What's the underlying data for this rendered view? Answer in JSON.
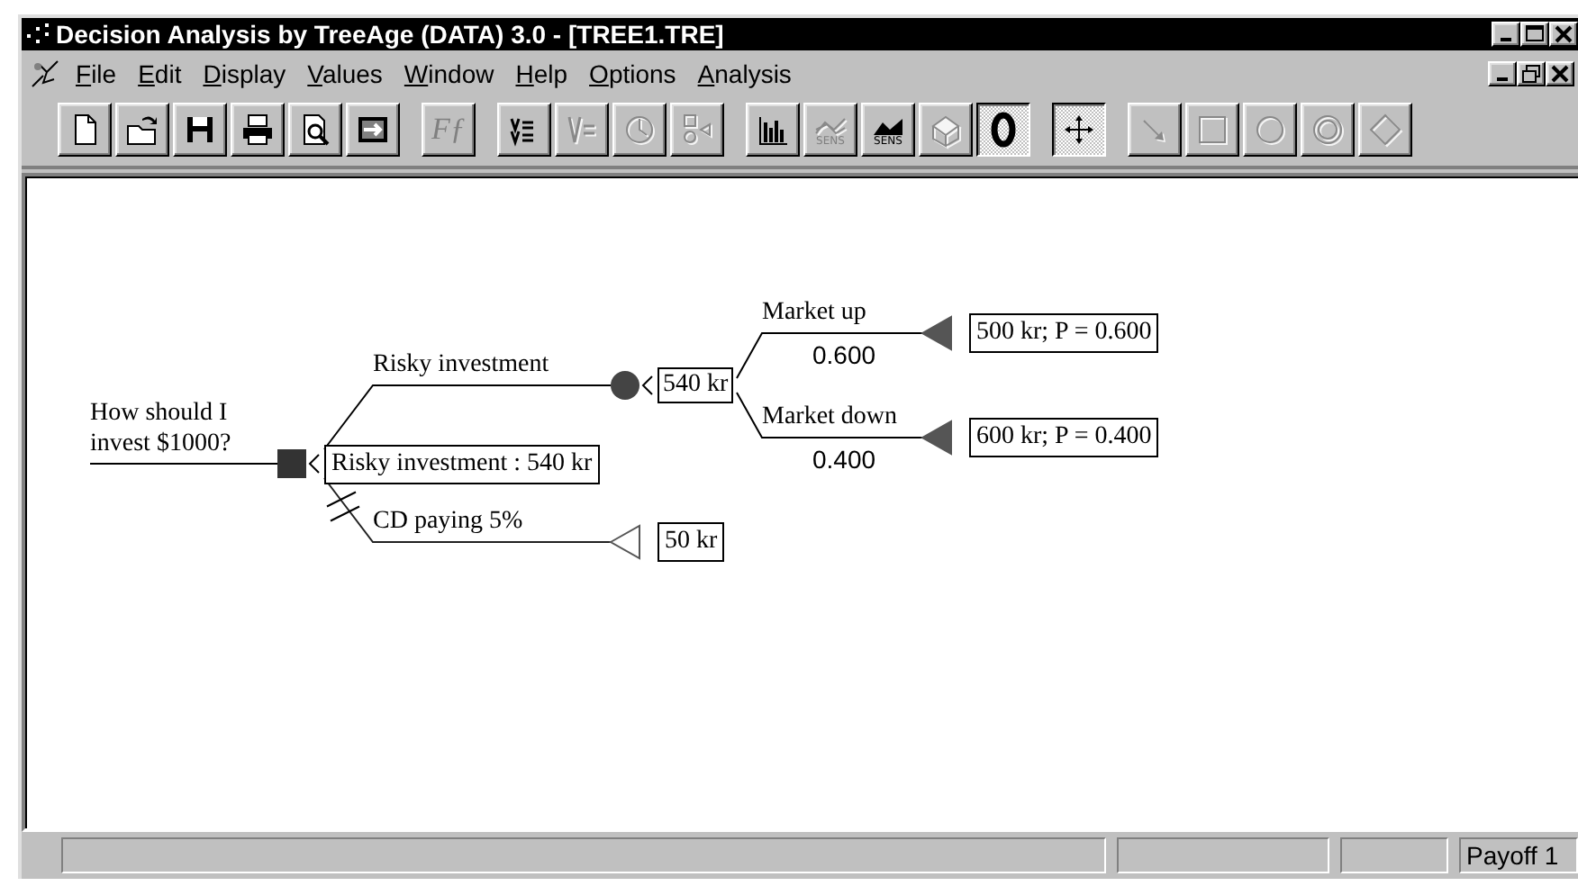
{
  "window": {
    "title": "Decision Analysis by TreeAge (DATA) 3.0 - [TREE1.TRE]"
  },
  "menu": [
    "File",
    "Edit",
    "Display",
    "Values",
    "Window",
    "Help",
    "Options",
    "Analysis"
  ],
  "toolbar": {
    "groups": [
      {
        "items": [
          {
            "kind": "new",
            "disabled": false,
            "pressed": false
          },
          {
            "kind": "open",
            "disabled": false,
            "pressed": false
          },
          {
            "kind": "save",
            "disabled": false,
            "pressed": false
          },
          {
            "kind": "print",
            "disabled": false,
            "pressed": false
          },
          {
            "kind": "preview",
            "disabled": false,
            "pressed": false
          },
          {
            "kind": "fit",
            "disabled": false,
            "pressed": false
          }
        ]
      },
      {
        "items": [
          {
            "kind": "glyph",
            "glyph": "Fƒ",
            "disabled": true,
            "pressed": false
          }
        ]
      },
      {
        "items": [
          {
            "kind": "values-list",
            "disabled": false,
            "pressed": false
          },
          {
            "kind": "values-eq",
            "disabled": true,
            "pressed": false
          },
          {
            "kind": "clock",
            "disabled": true,
            "pressed": false
          },
          {
            "kind": "node-types",
            "disabled": true,
            "pressed": false
          }
        ]
      },
      {
        "items": [
          {
            "kind": "bars",
            "disabled": false,
            "pressed": false
          },
          {
            "kind": "sens-line",
            "caption": "SENS",
            "disabled": true,
            "pressed": false
          },
          {
            "kind": "sens-area",
            "caption": "SENS",
            "disabled": false,
            "pressed": false
          },
          {
            "kind": "dice",
            "disabled": true,
            "pressed": false
          },
          {
            "kind": "bold-ring",
            "disabled": false,
            "pressed": true
          }
        ]
      },
      {
        "items": [
          {
            "kind": "move",
            "disabled": false,
            "pressed": true
          }
        ]
      },
      {
        "items": [
          {
            "kind": "arrow",
            "disabled": true,
            "pressed": false
          },
          {
            "kind": "square",
            "disabled": true,
            "pressed": false
          },
          {
            "kind": "circle",
            "disabled": true,
            "pressed": false
          },
          {
            "kind": "double-circle",
            "disabled": true,
            "pressed": false
          },
          {
            "kind": "diamond",
            "disabled": true,
            "pressed": false
          }
        ]
      }
    ]
  },
  "tree": {
    "root": {
      "kind": "decision",
      "label_lines": [
        "How should I",
        "invest $1000?"
      ],
      "value_label": "Risky investment : 540 kr",
      "branches": [
        {
          "label": "Risky investment",
          "selected": true,
          "node": {
            "kind": "chance",
            "value_label": "540 kr",
            "branches": [
              {
                "label": "Market up",
                "probability": "0.600",
                "selected": true,
                "node": {
                  "kind": "terminal",
                  "filled": true,
                  "value_label": "500 kr; P = 0.600"
                }
              },
              {
                "label": "Market down",
                "probability": "0.400",
                "selected": true,
                "node": {
                  "kind": "terminal",
                  "filled": true,
                  "value_label": "600 kr; P = 0.400"
                }
              }
            ]
          }
        },
        {
          "label": "CD paying 5%",
          "selected": false,
          "node": {
            "kind": "terminal",
            "filled": false,
            "value_label": "50 kr"
          }
        }
      ]
    }
  },
  "status_bar": {
    "panels": [
      {
        "kind": "blank"
      },
      {
        "kind": "blank"
      },
      {
        "kind": "blank"
      },
      {
        "kind": "text",
        "text": "Payoff 1"
      }
    ]
  }
}
